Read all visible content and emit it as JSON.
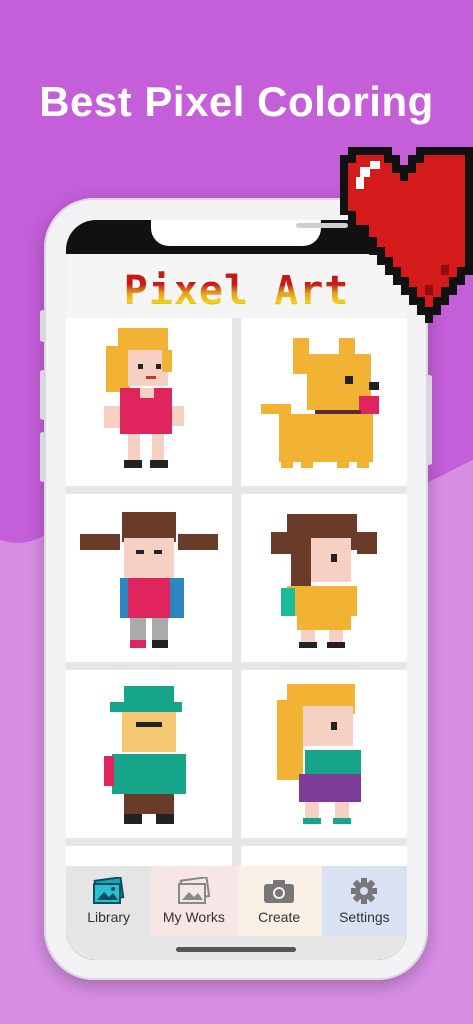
{
  "headline": "Best Pixel Coloring",
  "app": {
    "title": "Pixel Art"
  },
  "artworks": [
    {
      "name": "blonde-girl"
    },
    {
      "name": "orange-dog"
    },
    {
      "name": "pigtail-girl"
    },
    {
      "name": "brown-hair-girl"
    },
    {
      "name": "cap-boy"
    },
    {
      "name": "blonde-girl-purple-skirt"
    }
  ],
  "tabs": [
    {
      "label": "Library",
      "icon": "library-icon",
      "bg": "#e5e5e5",
      "active": true
    },
    {
      "label": "My Works",
      "icon": "my-works-icon",
      "bg": "#f6e6e6",
      "active": false
    },
    {
      "label": "Create",
      "icon": "camera-icon",
      "bg": "#f8efe5",
      "active": false
    },
    {
      "label": "Settings",
      "icon": "gear-icon",
      "bg": "#d9e2f3",
      "active": false
    }
  ],
  "colors": {
    "background": "#c45ed9",
    "wave": "#d98ee6",
    "heart": "#d41a1a"
  }
}
